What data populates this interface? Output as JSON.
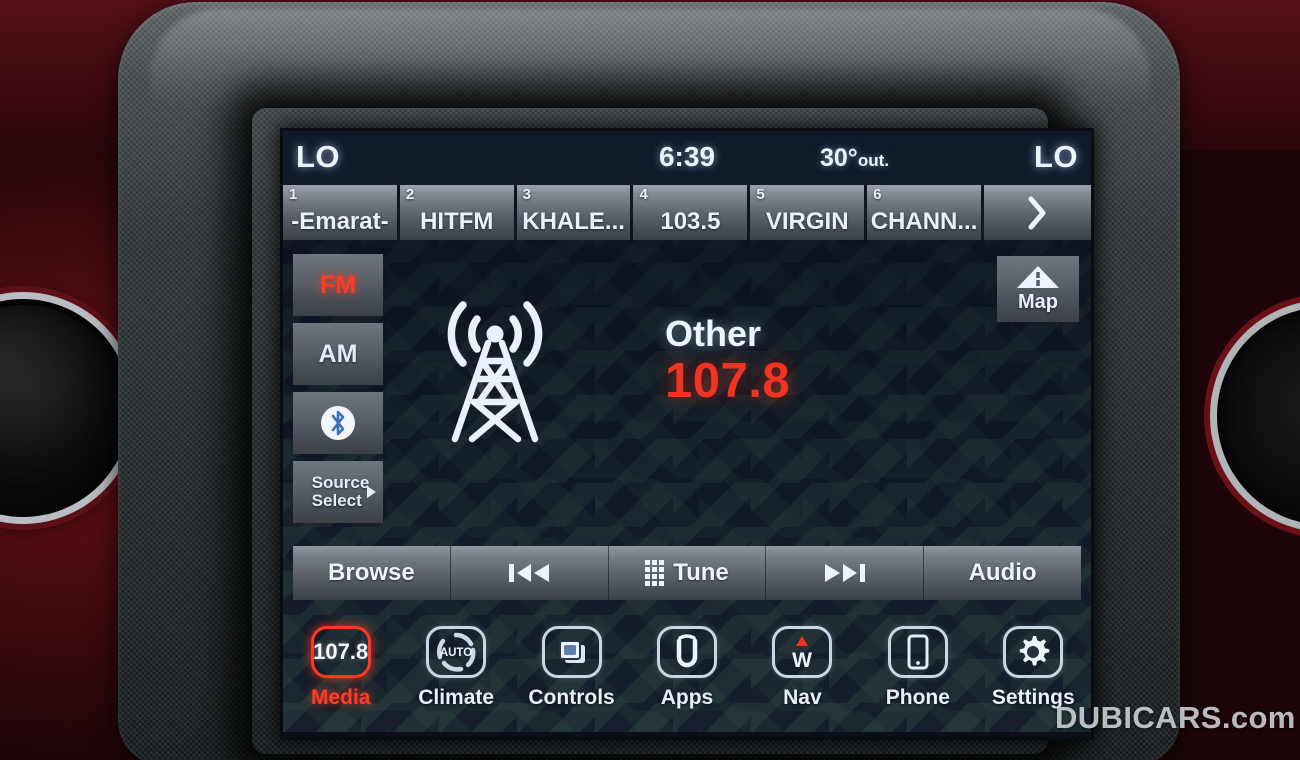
{
  "status_bar": {
    "climate_left": "LO",
    "clock": "6:39",
    "temperature": "30°",
    "temperature_suffix": "out.",
    "climate_right": "LO"
  },
  "presets": {
    "items": [
      {
        "number": "1",
        "name": "-Emarat-"
      },
      {
        "number": "2",
        "name": "HITFM"
      },
      {
        "number": "3",
        "name": "KHALE..."
      },
      {
        "number": "4",
        "name": "103.5"
      },
      {
        "number": "5",
        "name": "VIRGIN"
      },
      {
        "number": "6",
        "name": "CHANN..."
      }
    ],
    "next_page_icon": "chevron-right-icon"
  },
  "source_rail": {
    "fm_label": "FM",
    "am_label": "AM",
    "bluetooth_icon": "bluetooth-icon",
    "source_select_line1": "Source",
    "source_select_line2": "Select",
    "active_source": "FM"
  },
  "map_button": {
    "label": "Map",
    "icon": "road-perspective-icon"
  },
  "now_playing": {
    "tower_icon": "radio-tower-icon",
    "station_name": "Other",
    "frequency": "107.8",
    "band": "FM"
  },
  "media_controls": {
    "browse": "Browse",
    "previous_icon": "skip-previous-icon",
    "tune": "Tune",
    "tune_icon": "keypad-grid-icon",
    "next_icon": "skip-next-icon",
    "audio": "Audio"
  },
  "bottom_nav": {
    "items": [
      {
        "label": "Media",
        "icon": "frequency-tile-icon",
        "tile_text": "107.8",
        "active": true
      },
      {
        "label": "Climate",
        "icon": "auto-climate-icon",
        "tile_text": "AUTO",
        "active": false
      },
      {
        "label": "Controls",
        "icon": "stacked-windows-icon",
        "tile_text": "",
        "active": false
      },
      {
        "label": "Apps",
        "icon": "uconnect-u-icon",
        "tile_text": "",
        "active": false
      },
      {
        "label": "Nav",
        "icon": "compass-heading-icon",
        "tile_text": "W",
        "active": false
      },
      {
        "label": "Phone",
        "icon": "smartphone-icon",
        "tile_text": "",
        "active": false
      },
      {
        "label": "Settings",
        "icon": "gear-icon",
        "tile_text": "",
        "active": false
      }
    ]
  },
  "watermark": {
    "text": "DUBICARS.com"
  },
  "colors": {
    "accent_red": "#f03421",
    "screen_bg": "#121a29",
    "status_bar_bg": "#111a2b",
    "button_face": "#5b626a",
    "text_light": "#eef4fd"
  }
}
